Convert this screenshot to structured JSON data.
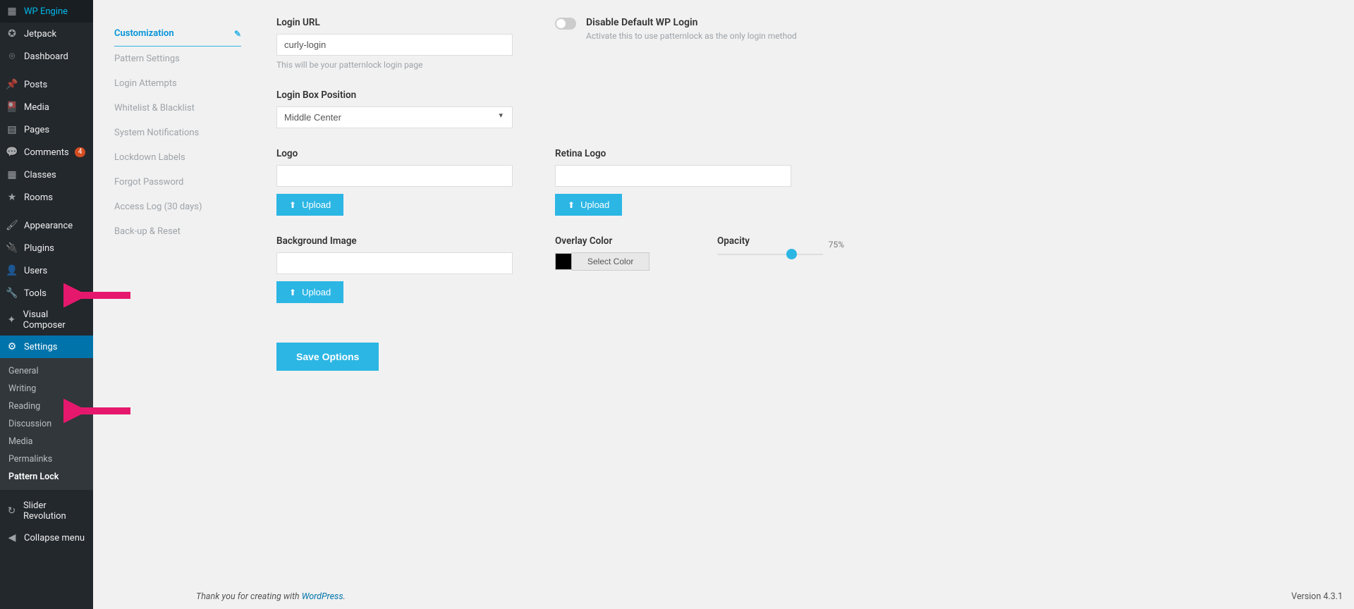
{
  "sidebar": {
    "items": [
      {
        "icon": "grid",
        "label": "WP Engine"
      },
      {
        "icon": "refresh",
        "label": "Jetpack"
      },
      {
        "icon": "gauge",
        "label": "Dashboard"
      },
      {
        "icon": "pin",
        "label": "Posts"
      },
      {
        "icon": "media",
        "label": "Media"
      },
      {
        "icon": "page",
        "label": "Pages"
      },
      {
        "icon": "comment",
        "label": "Comments",
        "badge": "4"
      },
      {
        "icon": "calendar",
        "label": "Classes"
      },
      {
        "icon": "star",
        "label": "Rooms"
      },
      {
        "icon": "brush",
        "label": "Appearance"
      },
      {
        "icon": "plug",
        "label": "Plugins"
      },
      {
        "icon": "user",
        "label": "Users"
      },
      {
        "icon": "wrench",
        "label": "Tools"
      },
      {
        "icon": "vc",
        "label": "Visual Composer"
      },
      {
        "icon": "sliders",
        "label": "Settings",
        "active": true
      },
      {
        "icon": "refresh2",
        "label": "Slider Revolution"
      },
      {
        "icon": "collapse",
        "label": "Collapse menu"
      }
    ],
    "settings_submenu": [
      {
        "label": "General"
      },
      {
        "label": "Writing"
      },
      {
        "label": "Reading"
      },
      {
        "label": "Discussion"
      },
      {
        "label": "Media"
      },
      {
        "label": "Permalinks"
      },
      {
        "label": "Pattern Lock",
        "current": true
      }
    ]
  },
  "tabs": [
    {
      "label": "Customization",
      "active": true
    },
    {
      "label": "Pattern Settings"
    },
    {
      "label": "Login Attempts"
    },
    {
      "label": "Whitelist & Blacklist"
    },
    {
      "label": "System Notifications"
    },
    {
      "label": "Lockdown Labels"
    },
    {
      "label": "Forgot Password"
    },
    {
      "label": "Access Log (30 days)"
    },
    {
      "label": "Back-up & Reset"
    }
  ],
  "fields": {
    "login_url": {
      "label": "Login URL",
      "value": "curly-login",
      "hint": "This will be your patternlock login page"
    },
    "disable_default": {
      "label": "Disable Default WP Login",
      "hint": "Activate this to use patternlock as the only login method"
    },
    "login_box_position": {
      "label": "Login Box Position",
      "value": "Middle Center"
    },
    "logo": {
      "label": "Logo"
    },
    "retina_logo": {
      "label": "Retina Logo"
    },
    "bg_image": {
      "label": "Background Image"
    },
    "overlay_color": {
      "label": "Overlay Color",
      "button": "Select Color"
    },
    "opacity": {
      "label": "Opacity",
      "value": "75%"
    },
    "upload_btn": "Upload",
    "save_btn": "Save Options"
  },
  "footer": {
    "thanks_prefix": "Thank you for creating with ",
    "thanks_link": "WordPress",
    "thanks_suffix": ".",
    "version": "Version 4.3.1"
  }
}
